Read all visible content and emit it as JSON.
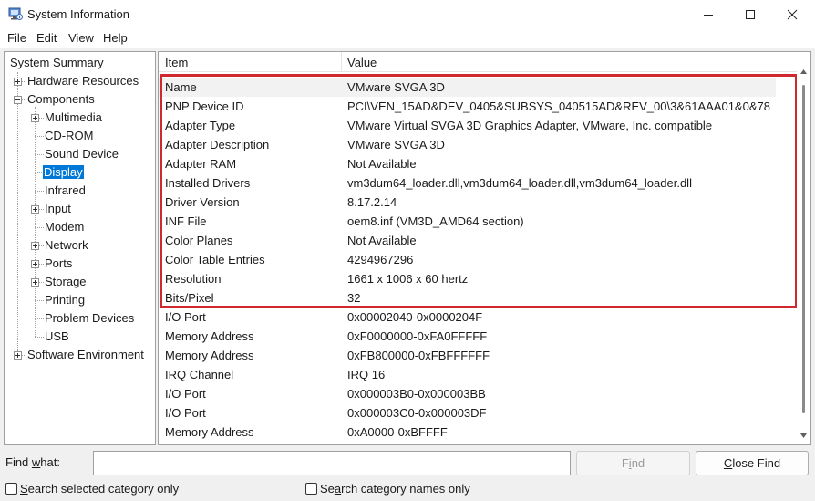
{
  "window": {
    "title": "System Information",
    "minimize_icon": "minimize-icon",
    "maximize_icon": "maximize-icon",
    "close_icon": "close-icon"
  },
  "menu": [
    "File",
    "Edit",
    "View",
    "Help"
  ],
  "tree": {
    "root": "System Summary",
    "hardware_resources": "Hardware Resources",
    "components": "Components",
    "children": [
      "Multimedia",
      "CD-ROM",
      "Sound Device",
      "Display",
      "Infrared",
      "Input",
      "Modem",
      "Network",
      "Ports",
      "Storage",
      "Printing",
      "Problem Devices",
      "USB"
    ],
    "software_environment": "Software Environment",
    "selected": "Display"
  },
  "table": {
    "columns": [
      "Item",
      "Value"
    ],
    "rows": [
      {
        "item": "Name",
        "value": "VMware SVGA 3D"
      },
      {
        "item": "PNP Device ID",
        "value": "PCI\\VEN_15AD&DEV_0405&SUBSYS_040515AD&REV_00\\3&61AAA01&0&78"
      },
      {
        "item": "Adapter Type",
        "value": "VMware Virtual SVGA 3D Graphics Adapter, VMware, Inc. compatible"
      },
      {
        "item": "Adapter Description",
        "value": "VMware SVGA 3D"
      },
      {
        "item": "Adapter RAM",
        "value": "Not Available"
      },
      {
        "item": "Installed Drivers",
        "value": "vm3dum64_loader.dll,vm3dum64_loader.dll,vm3dum64_loader.dll"
      },
      {
        "item": "Driver Version",
        "value": "8.17.2.14"
      },
      {
        "item": "INF File",
        "value": "oem8.inf (VM3D_AMD64 section)"
      },
      {
        "item": "Color Planes",
        "value": "Not Available"
      },
      {
        "item": "Color Table Entries",
        "value": "4294967296"
      },
      {
        "item": "Resolution",
        "value": "1661 x 1006 x 60 hertz"
      },
      {
        "item": "Bits/Pixel",
        "value": "32"
      },
      {
        "item": "I/O Port",
        "value": "0x00002040-0x0000204F"
      },
      {
        "item": "Memory Address",
        "value": "0xF0000000-0xFA0FFFFF"
      },
      {
        "item": "Memory Address",
        "value": "0xFB800000-0xFBFFFFFF"
      },
      {
        "item": "IRQ Channel",
        "value": "IRQ 16"
      },
      {
        "item": "I/O Port",
        "value": "0x000003B0-0x000003BB"
      },
      {
        "item": "I/O Port",
        "value": "0x000003C0-0x000003DF"
      },
      {
        "item": "Memory Address",
        "value": "0xA0000-0xBFFFF"
      }
    ]
  },
  "find": {
    "label_pre": "Find ",
    "label_ul": "w",
    "label_post": "hat:",
    "input_value": "",
    "find_button_pre": "F",
    "find_button_ul": "i",
    "find_button_post": "nd",
    "close_button_ul": "C",
    "close_button_post": "lose Find",
    "check1_ul": "S",
    "check1_post": "earch selected category only",
    "check1_checked": false,
    "check2_pre": "Se",
    "check2_ul": "a",
    "check2_post": "rch category names only",
    "check2_checked": false
  },
  "colors": {
    "highlight_border": "#d0282f",
    "selection": "#0078d7"
  }
}
